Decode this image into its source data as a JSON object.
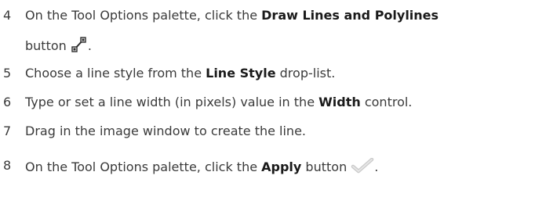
{
  "steps": [
    {
      "number": "4",
      "pre": "On the Tool Options palette, click the ",
      "bold": "Draw Lines and Polylines",
      "line2_pre": "button ",
      "line2_post": ".",
      "icon": "draw-lines-polylines-icon"
    },
    {
      "number": "5",
      "pre": "Choose a line style from the ",
      "bold": "Line Style",
      "post": " drop-list."
    },
    {
      "number": "6",
      "pre": "Type or set a line width (in pixels) value in the ",
      "bold": "Width",
      "post": " control."
    },
    {
      "number": "7",
      "pre": "Drag in the image window to create the line."
    },
    {
      "number": "8",
      "pre": "On the Tool Options palette, click the ",
      "bold": "Apply",
      "post": " button ",
      "post2": ".",
      "icon": "apply-checkmark-icon"
    }
  ]
}
